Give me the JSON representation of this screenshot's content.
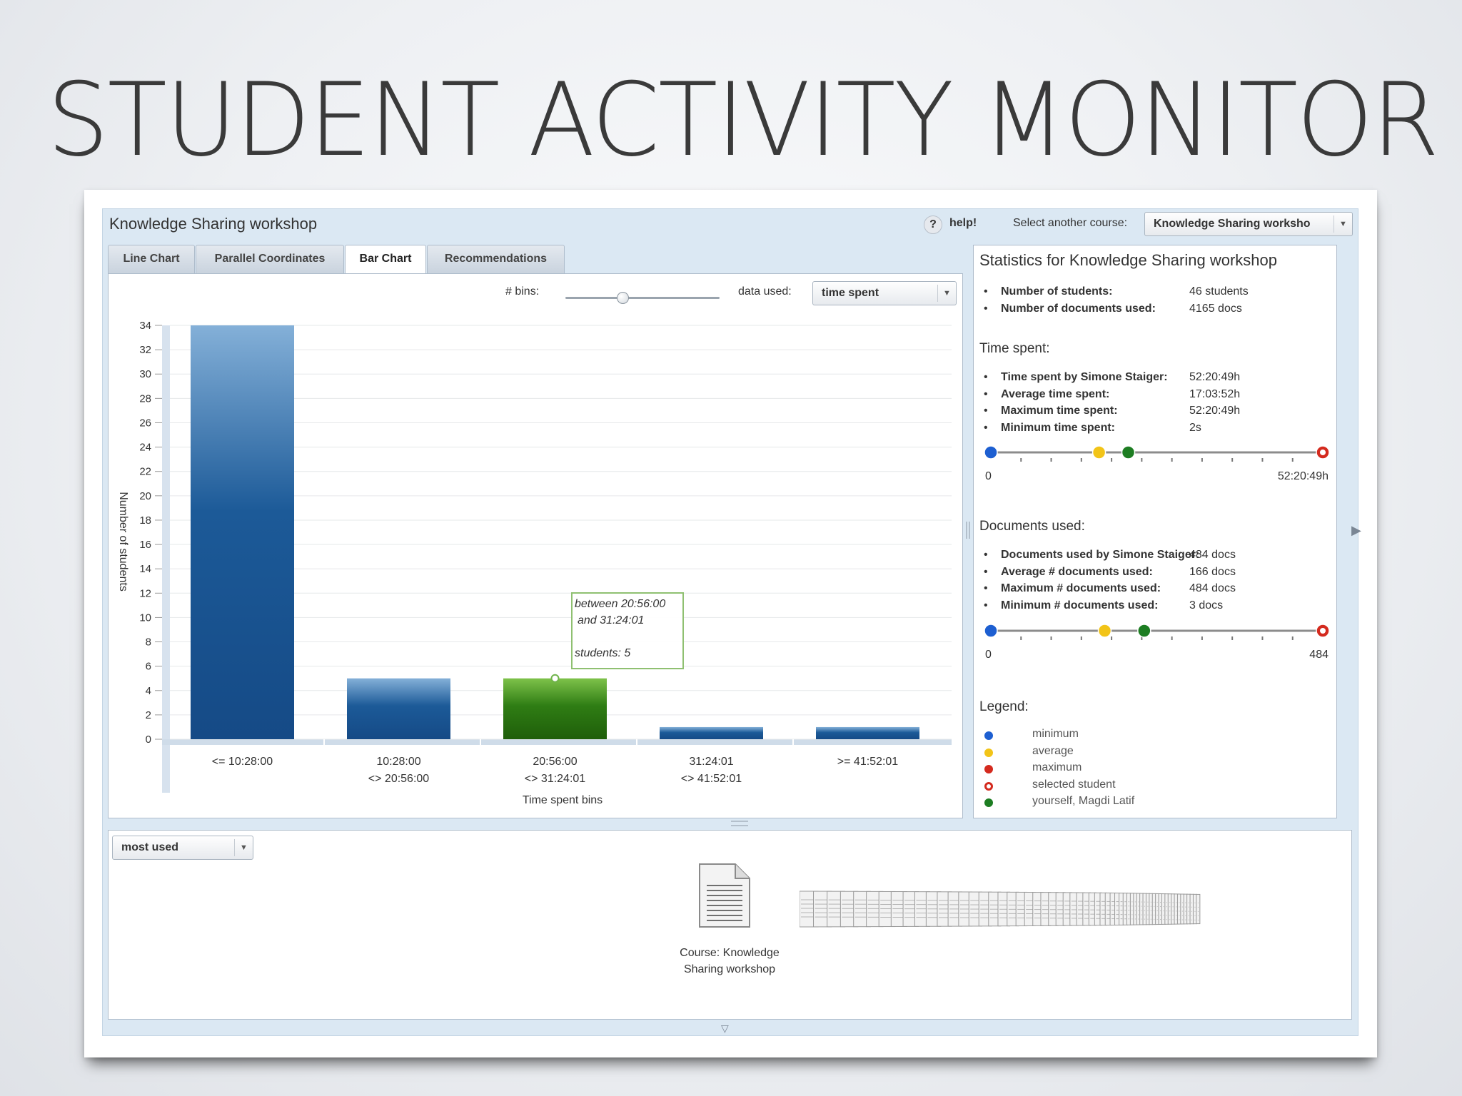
{
  "slide": {
    "title": "STUDENT ACTIVITY MONITOR"
  },
  "app": {
    "title": "Knowledge Sharing workshop",
    "help": "help!",
    "select_course_label": "Select another course:",
    "selected_course": "Knowledge Sharing worksho"
  },
  "tabs": [
    {
      "label": "Line Chart"
    },
    {
      "label": "Parallel Coordinates"
    },
    {
      "label": "Bar Chart",
      "active": true
    },
    {
      "label": "Recommendations"
    }
  ],
  "controls": {
    "bins_label": "# bins:",
    "data_used_label": "data used:",
    "data_used_value": "time spent"
  },
  "chart_data": {
    "type": "bar",
    "xlabel": "Time spent bins",
    "ylabel": "Number of students",
    "ylim": [
      0,
      34
    ],
    "yticks": [
      0,
      2,
      4,
      6,
      8,
      10,
      12,
      14,
      16,
      18,
      20,
      22,
      24,
      26,
      28,
      30,
      32,
      34
    ],
    "categories": [
      [
        "<= 10:28:00"
      ],
      [
        "10:28:00",
        "<> 20:56:00"
      ],
      [
        "20:56:00",
        "<> 31:24:01"
      ],
      [
        "31:24:01",
        "<> 41:52:01"
      ],
      [
        ">= 41:52:01"
      ]
    ],
    "values": [
      34,
      5,
      5,
      1,
      1
    ],
    "highlighted_index": 2,
    "colors": {
      "bar": "#1c5a98",
      "highlight": "#2f7d14"
    },
    "tooltip": {
      "line1": "between 20:56:00",
      "line2": "and 31:24:01",
      "line3": "students: 5"
    }
  },
  "stats": {
    "title": "Statistics for Knowledge Sharing workshop",
    "general": [
      {
        "label": "Number of students:",
        "value": "46 students"
      },
      {
        "label": "Number of documents used:",
        "value": "4165 docs"
      }
    ],
    "time_heading": "Time spent:",
    "time": [
      {
        "label": "Time spent by Simone Staiger:",
        "value": "52:20:49h"
      },
      {
        "label": "Average time spent:",
        "value": "17:03:52h"
      },
      {
        "label": "Maximum time spent:",
        "value": "52:20:49h"
      },
      {
        "label": "Minimum time spent:",
        "value": "2s"
      }
    ],
    "time_scale": {
      "min_label": "0",
      "max_label": "52:20:49h",
      "min": 0,
      "avg": 0.326,
      "you": 0.414,
      "max": 1.0,
      "selected": 1.0
    },
    "docs_heading": "Documents used:",
    "docs": [
      {
        "label": "Documents used by Simone Staiger:",
        "value": "484 docs"
      },
      {
        "label": "Average # documents used:",
        "value": "166 docs"
      },
      {
        "label": "Maximum # documents used:",
        "value": "484 docs"
      },
      {
        "label": "Minimum # documents used:",
        "value": "3 docs"
      }
    ],
    "docs_scale": {
      "min_label": "0",
      "max_label": "484",
      "min": 0,
      "avg": 0.343,
      "you": 0.462,
      "max": 1.0,
      "selected": 1.0
    },
    "legend_heading": "Legend:",
    "legend": [
      {
        "label": "minimum",
        "color": "#1d5fd1"
      },
      {
        "label": "average",
        "color": "#f2c418"
      },
      {
        "label": "maximum",
        "color": "#d42a1e"
      },
      {
        "label": "selected student",
        "color": "#d42a1e",
        "ring": true
      },
      {
        "label": "yourself, Magdi Latif",
        "color": "#1d7d22"
      }
    ]
  },
  "lower": {
    "sort_value": "most used",
    "course_caption_line1": "Course: Knowledge",
    "course_caption_line2": "Sharing workshop"
  }
}
